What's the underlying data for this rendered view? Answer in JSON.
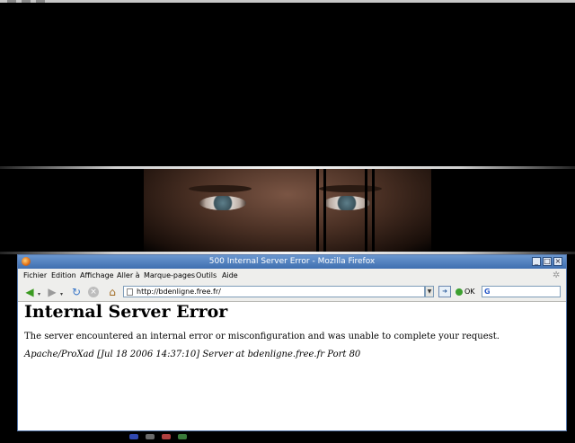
{
  "window": {
    "title": "500 Internal Server Error - Mozilla Firefox"
  },
  "menubar": {
    "items": [
      "Fichier",
      "Edition",
      "Affichage",
      "Aller à",
      "Marque-pages",
      "Outils",
      "Aide"
    ]
  },
  "toolbar": {
    "url": "http://bdenligne.free.fr/",
    "ok_label": "OK",
    "icons": {
      "back": "back-arrow-icon",
      "forward": "forward-arrow-icon",
      "reload": "reload-icon",
      "stop": "stop-icon",
      "home": "home-icon",
      "go": "go-icon",
      "search_engine": "google-icon"
    }
  },
  "page": {
    "heading": "Internal Server Error",
    "message": "The server encountered an internal error or misconfiguration and was unable to complete your request.",
    "address": "Apache/ProXad [Jul 18 2006 14:37:10] Server at bdenligne.free.fr Port 80"
  },
  "colors": {
    "titlebar": "#4a7bbd",
    "chrome": "#eeeeec",
    "wallpaper": "#000000"
  }
}
